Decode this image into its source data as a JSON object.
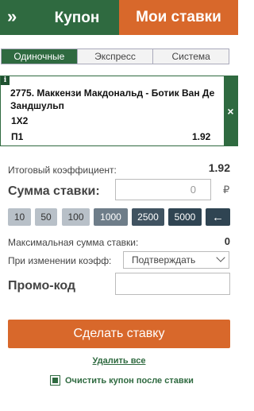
{
  "header": {
    "coupon_tab": "Купон",
    "my_bets_tab": "Мои ставки",
    "expand_icon": "double-chevron-right"
  },
  "modes": [
    "Одиночные",
    "Экспресс",
    "Система"
  ],
  "active_mode": "Одиночные",
  "bet": {
    "info": "i",
    "title": "2775. Маккензи Макдональд - Ботик Ван Де Зандшульп",
    "market": "1X2",
    "selection": "П1",
    "odd": "1.92",
    "remove": "×"
  },
  "summary": {
    "total_odd_label": "Итоговый коэффициент:",
    "total_odd_value": "1.92",
    "stake_label": "Сумма ставки:",
    "stake_value": "0",
    "currency": "₽",
    "quick_amounts": [
      "10",
      "50",
      "100",
      "1000",
      "2500",
      "5000"
    ],
    "backspace_icon": "arrow-left",
    "max_stake_label": "Максимальная сумма ставки:",
    "max_stake_value": "0",
    "odds_change_label": "При изменении коэфф:",
    "odds_change_value": "Подтверждать",
    "promo_label": "Промо-код",
    "promo_value": ""
  },
  "actions": {
    "place_bet": "Сделать ставку",
    "delete_all": "Удалить все",
    "clear_after_bet": "Очистить купон после ставки",
    "clear_after_bet_checked": true
  },
  "colors": {
    "green": "#2f6a40",
    "orange": "#d8682b"
  }
}
